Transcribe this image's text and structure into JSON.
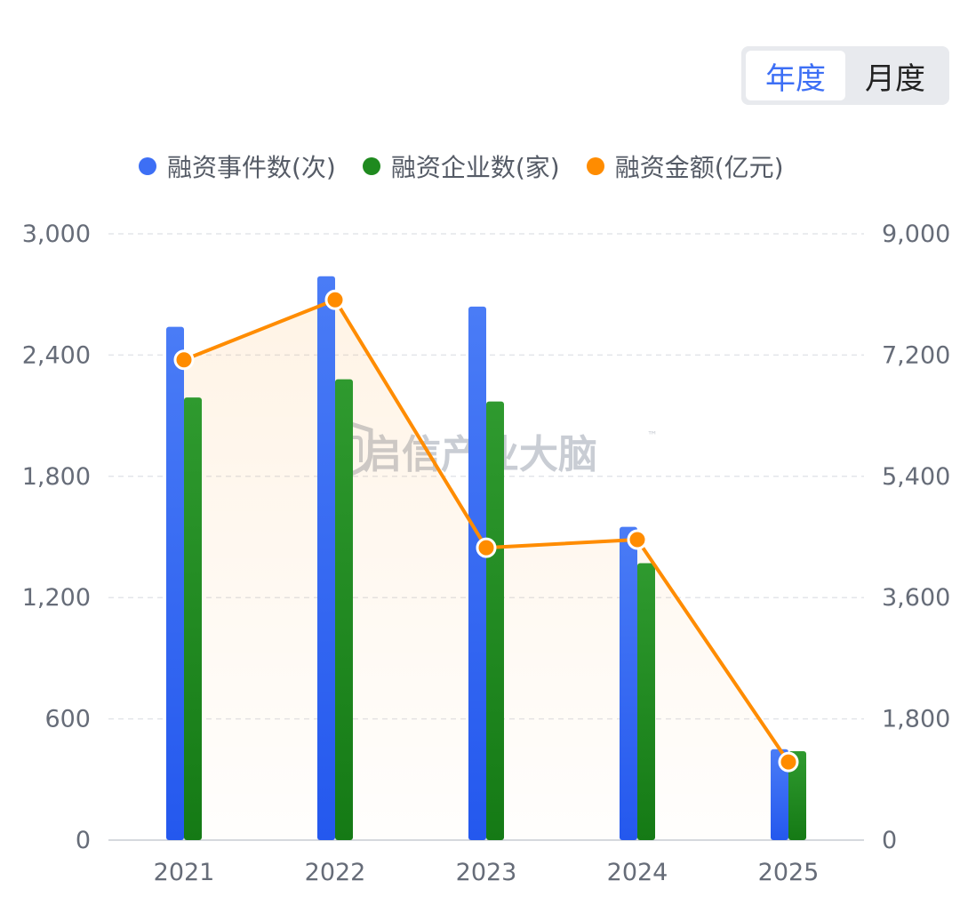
{
  "toggle": {
    "options": [
      "年度",
      "月度"
    ],
    "active_index": 0
  },
  "legend": [
    {
      "label": "融资事件数(次)",
      "color": "#3d6ff5"
    },
    {
      "label": "融资企业数(家)",
      "color": "#1f8a1f"
    },
    {
      "label": "融资金额(亿元)",
      "color": "#ff8c00"
    }
  ],
  "watermark": {
    "text": "启信产业大脑",
    "tm": "™"
  },
  "chart_data": {
    "type": "bar",
    "categories": [
      "2021",
      "2022",
      "2023",
      "2024",
      "2025"
    ],
    "series": [
      {
        "name": "融资事件数(次)",
        "type": "bar",
        "axis": "left",
        "color": "#3d6ff5",
        "values": [
          2540,
          2790,
          2640,
          1550,
          450
        ]
      },
      {
        "name": "融资企业数(家)",
        "type": "bar",
        "axis": "left",
        "color": "#1f8a1f",
        "values": [
          2190,
          2280,
          2170,
          1370,
          440
        ]
      },
      {
        "name": "融资金额(亿元)",
        "type": "line",
        "axis": "right",
        "color": "#ff8c00",
        "values": [
          7130,
          8020,
          4340,
          4460,
          1160
        ]
      }
    ],
    "y_left": {
      "ticks": [
        "0",
        "600",
        "1,200",
        "1,800",
        "2,400",
        "3,000"
      ],
      "range": [
        0,
        3000
      ]
    },
    "y_right": {
      "ticks": [
        "0",
        "1,800",
        "3,600",
        "5,400",
        "7,200",
        "9,000"
      ],
      "range": [
        0,
        9000
      ]
    },
    "grid": true,
    "legend_position": "top"
  }
}
